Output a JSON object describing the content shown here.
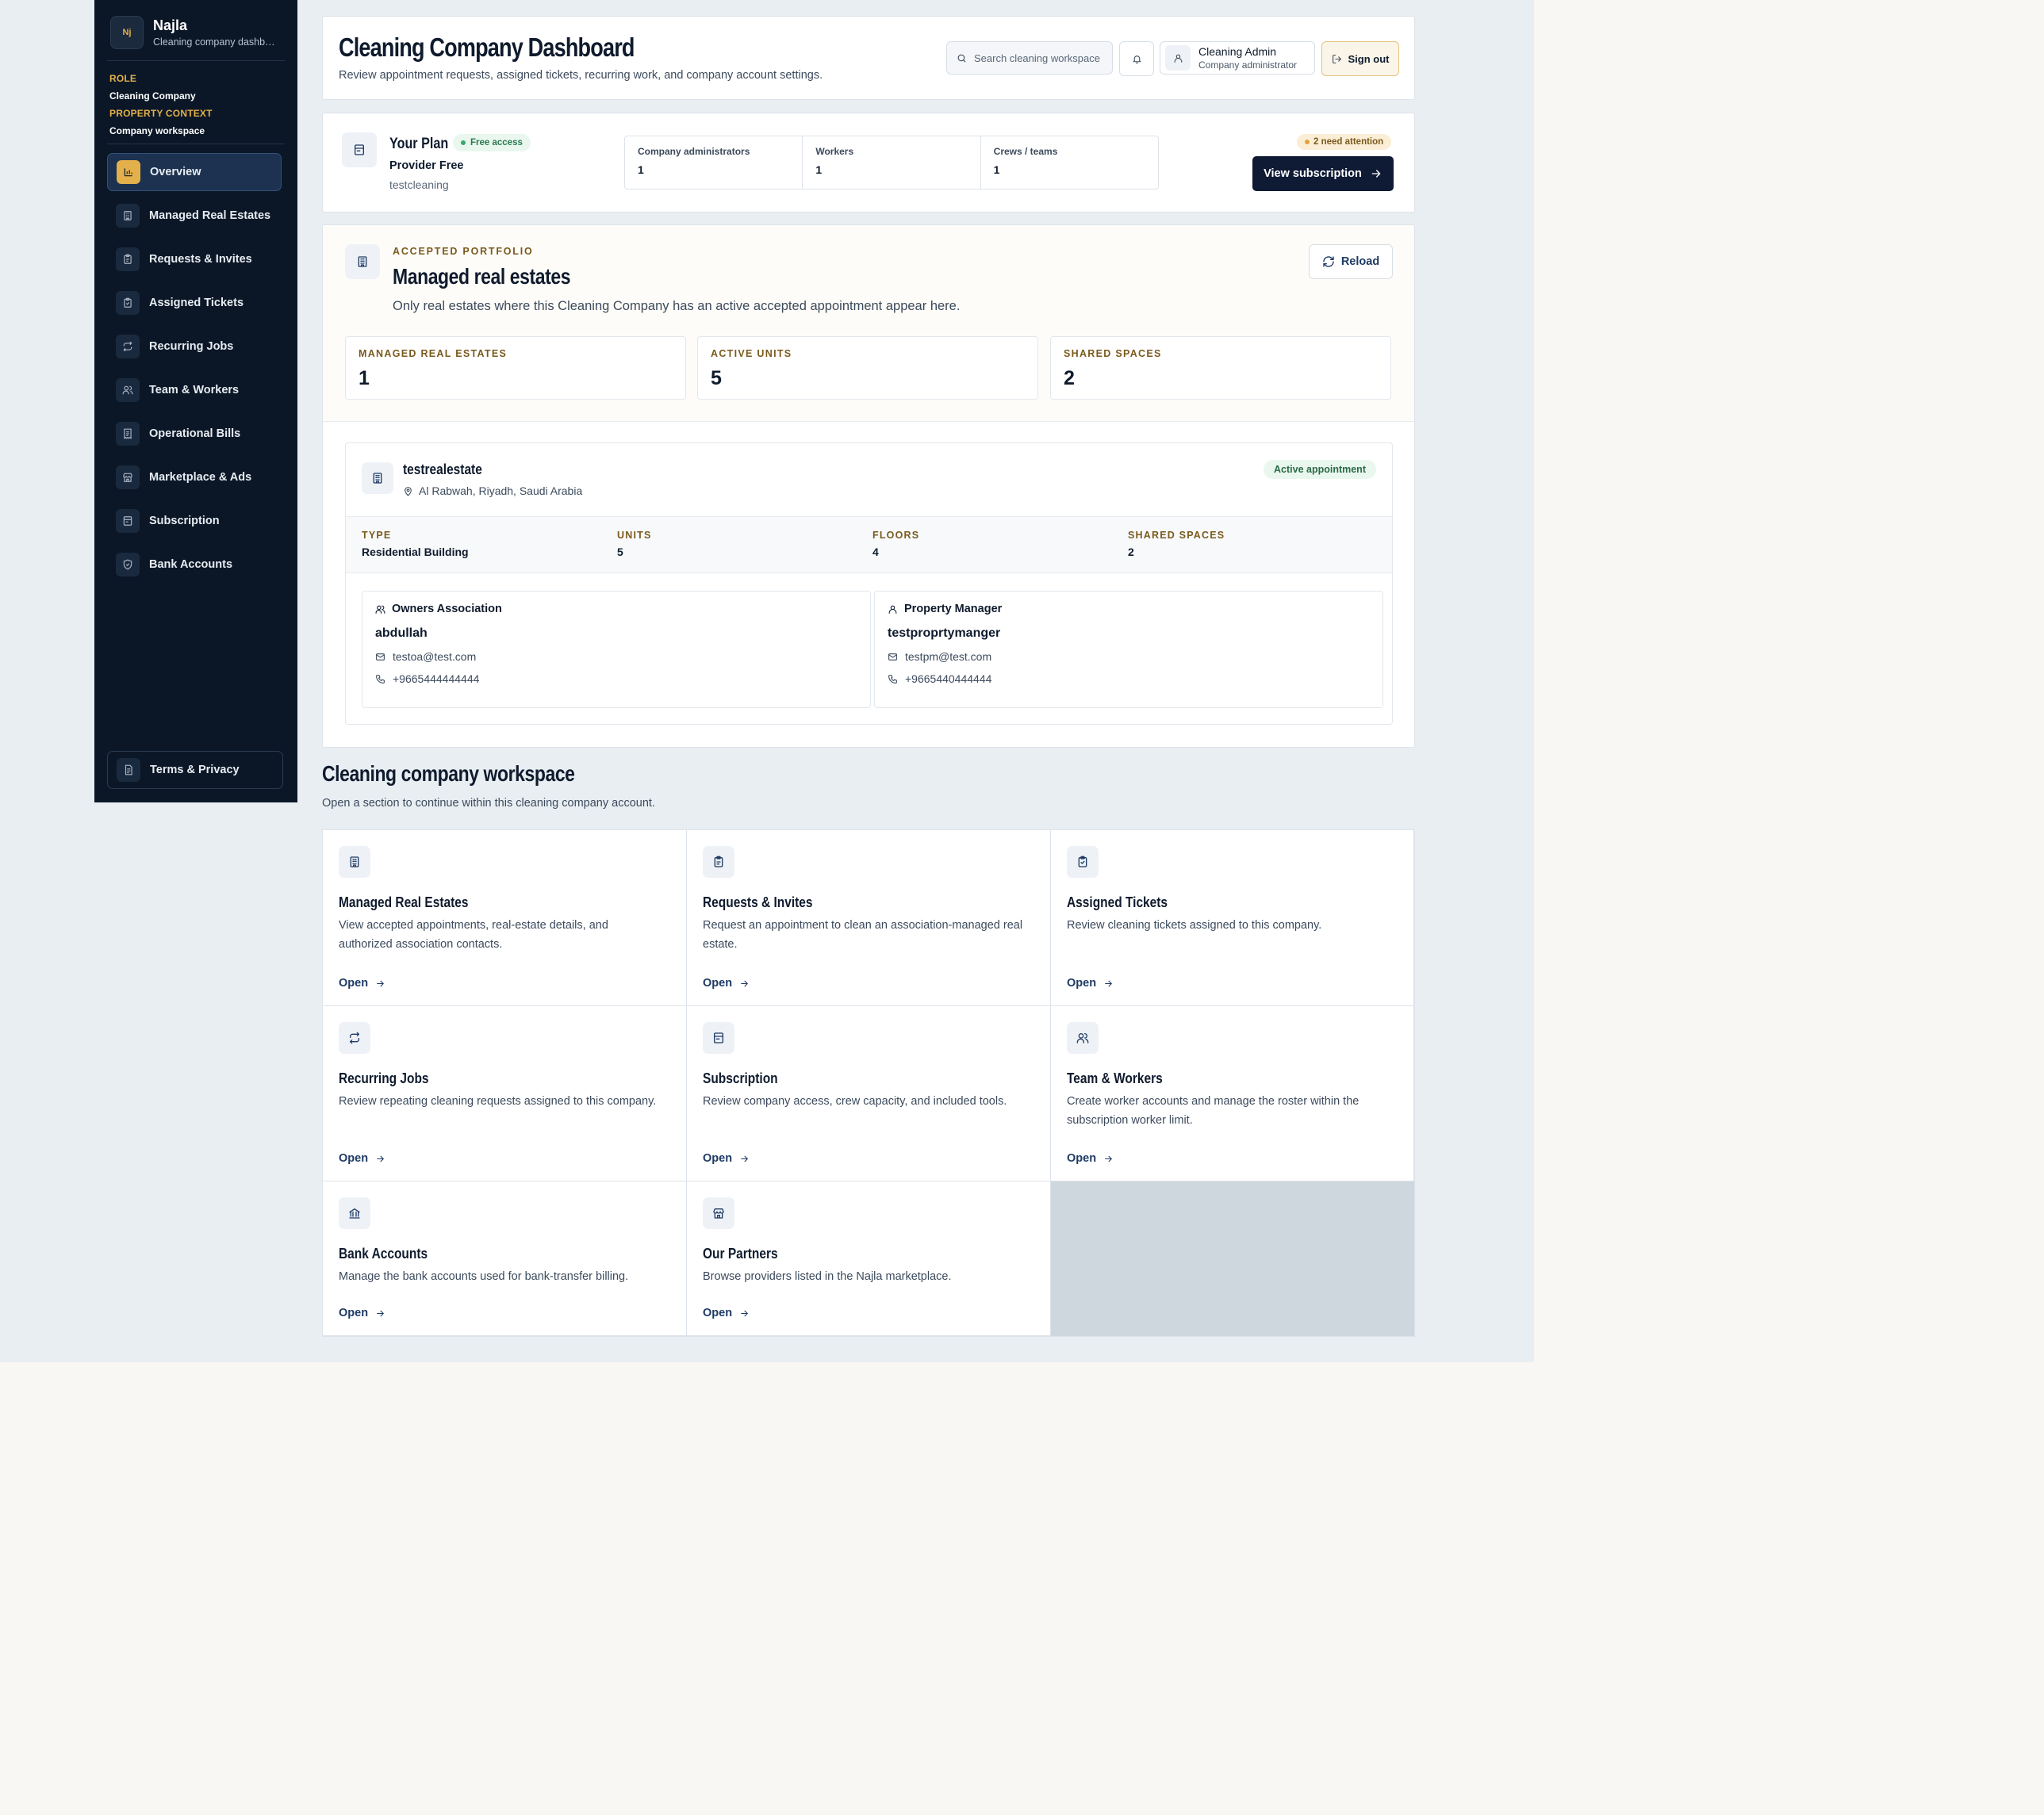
{
  "sidebar": {
    "brand_logo": "Nj",
    "brand_name": "Najla",
    "brand_sub": "Cleaning company dashboard",
    "role_label": "ROLE",
    "role_value": "Cleaning Company",
    "context_label": "PROPERTY CONTEXT",
    "context_value": "Company workspace",
    "items": [
      {
        "label": "Overview",
        "icon": "chart-icon"
      },
      {
        "label": "Managed Real Estates",
        "icon": "building-icon"
      },
      {
        "label": "Requests & Invites",
        "icon": "clipboard-icon"
      },
      {
        "label": "Assigned Tickets",
        "icon": "clipboard-check-icon"
      },
      {
        "label": "Recurring Jobs",
        "icon": "repeat-icon"
      },
      {
        "label": "Team & Workers",
        "icon": "users-icon"
      },
      {
        "label": "Operational Bills",
        "icon": "receipt-icon"
      },
      {
        "label": "Marketplace & Ads",
        "icon": "store-icon"
      },
      {
        "label": "Subscription",
        "icon": "card-icon"
      },
      {
        "label": "Bank Accounts",
        "icon": "shield-icon"
      }
    ],
    "terms_label": "Terms & Privacy"
  },
  "header": {
    "title": "Cleaning Company Dashboard",
    "subtitle": "Review appointment requests, assigned tickets, recurring work, and company account settings.",
    "search_placeholder": "Search cleaning workspace",
    "user_name": "Cleaning Admin",
    "user_role": "Company administrator",
    "signout_label": "Sign out"
  },
  "plan": {
    "title": "Your Plan",
    "badge": "Free access",
    "name": "Provider Free",
    "account": "testcleaning",
    "stats": [
      {
        "label": "Company administrators",
        "value": "1"
      },
      {
        "label": "Workers",
        "value": "1"
      },
      {
        "label": "Crews / teams",
        "value": "1"
      }
    ],
    "attention": "2 need attention",
    "view_label": "View subscription"
  },
  "portfolio": {
    "eyebrow": "ACCEPTED PORTFOLIO",
    "title": "Managed real estates",
    "subtitle": "Only real estates where this Cleaning Company has an active accepted appointment appear here.",
    "reload_label": "Reload",
    "metrics": [
      {
        "label": "MANAGED REAL ESTATES",
        "value": "1"
      },
      {
        "label": "ACTIVE UNITS",
        "value": "5"
      },
      {
        "label": "SHARED SPACES",
        "value": "2"
      }
    ],
    "estate": {
      "name": "testrealestate",
      "location": "Al Rabwah, Riyadh, Saudi Arabia",
      "status": "Active appointment",
      "facts": [
        {
          "label": "TYPE",
          "value": "Residential Building"
        },
        {
          "label": "UNITS",
          "value": "5"
        },
        {
          "label": "FLOORS",
          "value": "4"
        },
        {
          "label": "SHARED SPACES",
          "value": "2"
        }
      ],
      "contacts": [
        {
          "role": "Owners Association",
          "name": "abdullah",
          "email": "testoa@test.com",
          "phone": "+9665444444444"
        },
        {
          "role": "Property Manager",
          "name": "testproprtymanger",
          "email": "testpm@test.com",
          "phone": "+9665440444444"
        }
      ]
    }
  },
  "workspace": {
    "title": "Cleaning company workspace",
    "subtitle": "Open a section to continue within this cleaning company account.",
    "open_label": "Open",
    "tiles": [
      {
        "title": "Managed Real Estates",
        "desc": "View accepted appointments, real-estate details, and authorized association contacts.",
        "icon": "building-icon"
      },
      {
        "title": "Requests & Invites",
        "desc": "Request an appointment to clean an association-managed real estate.",
        "icon": "clipboard-icon"
      },
      {
        "title": "Assigned Tickets",
        "desc": "Review cleaning tickets assigned to this company.",
        "icon": "clipboard-check-icon"
      },
      {
        "title": "Recurring Jobs",
        "desc": "Review repeating cleaning requests assigned to this company.",
        "icon": "repeat-icon"
      },
      {
        "title": "Subscription",
        "desc": "Review company access, crew capacity, and included tools.",
        "icon": "card-icon"
      },
      {
        "title": "Team & Workers",
        "desc": "Create worker accounts and manage the roster within the subscription worker limit.",
        "icon": "users-icon"
      },
      {
        "title": "Bank Accounts",
        "desc": "Manage the bank accounts used for bank-transfer billing.",
        "icon": "bank-icon"
      },
      {
        "title": "Our Partners",
        "desc": "Browse providers listed in the Najla marketplace.",
        "icon": "store-icon"
      }
    ]
  }
}
